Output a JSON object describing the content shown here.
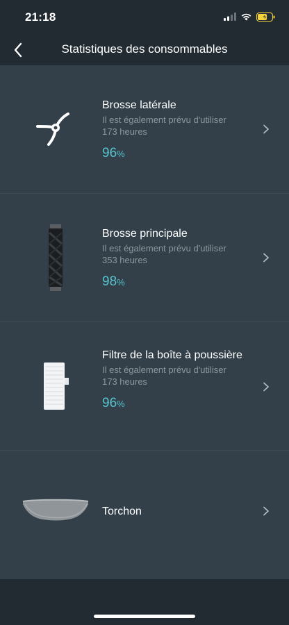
{
  "status_bar": {
    "time": "21:18",
    "icons": [
      "cellular-signal-icon",
      "wifi-icon",
      "battery-charging-icon"
    ],
    "battery_color": "#f4d23b"
  },
  "header": {
    "title": "Statistiques des consommables",
    "back_icon": "chevron-left-icon"
  },
  "colors": {
    "background": "#334049",
    "bar": "#222b32",
    "accent": "#56c3cf",
    "secondary_text": "#8d979d"
  },
  "items": [
    {
      "name": "Brosse latérale",
      "description": "Il est également prévu d'utiliser",
      "hours": "173 heures",
      "percent": "96",
      "percent_unit": "%",
      "icon": "side-brush-icon"
    },
    {
      "name": "Brosse principale",
      "description": "Il est également prévu d'utiliser",
      "hours": "353 heures",
      "percent": "98",
      "percent_unit": "%",
      "icon": "main-brush-icon"
    },
    {
      "name": "Filtre de la boîte à poussière",
      "description": "Il est également prévu d'utiliser",
      "hours": "173 heures",
      "percent": "96",
      "percent_unit": "%",
      "icon": "dust-filter-icon"
    },
    {
      "name": "Torchon",
      "icon": "mop-cloth-icon"
    }
  ]
}
